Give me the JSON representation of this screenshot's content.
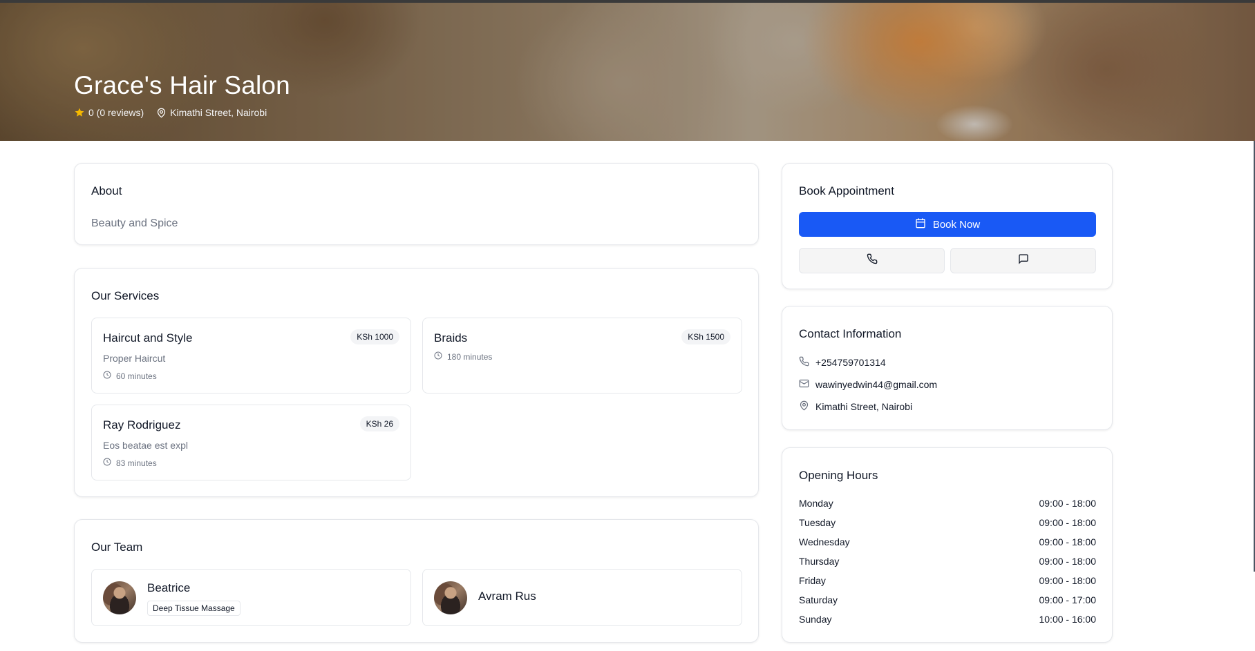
{
  "salon": {
    "name": "Grace's Hair Salon",
    "rating_text": "0 (0 reviews)",
    "location": "Kimathi Street, Nairobi"
  },
  "about": {
    "title": "About",
    "text": "Beauty and Spice"
  },
  "services": {
    "title": "Our Services",
    "items": [
      {
        "name": "Haircut and Style",
        "price": "KSh 1000",
        "description": "Proper Haircut",
        "duration": "60 minutes"
      },
      {
        "name": "Braids",
        "price": "KSh 1500",
        "description": "",
        "duration": "180 minutes"
      },
      {
        "name": "Ray Rodriguez",
        "price": "KSh 26",
        "description": "Eos beatae est expl",
        "duration": "83 minutes"
      }
    ]
  },
  "team": {
    "title": "Our Team",
    "members": [
      {
        "name": "Beatrice",
        "specialty": "Deep Tissue Massage"
      },
      {
        "name": "Avram Rus",
        "specialty": ""
      }
    ]
  },
  "booking": {
    "title": "Book Appointment",
    "book_label": "Book Now",
    "call_icon": "phone-icon",
    "message_icon": "message-icon"
  },
  "contact": {
    "title": "Contact Information",
    "phone": "+254759701314",
    "email": "wawinyedwin44@gmail.com",
    "address": "Kimathi Street, Nairobi"
  },
  "hours": {
    "title": "Opening Hours",
    "days": [
      {
        "day": "Monday",
        "time": "09:00 - 18:00"
      },
      {
        "day": "Tuesday",
        "time": "09:00 - 18:00"
      },
      {
        "day": "Wednesday",
        "time": "09:00 - 18:00"
      },
      {
        "day": "Thursday",
        "time": "09:00 - 18:00"
      },
      {
        "day": "Friday",
        "time": "09:00 - 18:00"
      },
      {
        "day": "Saturday",
        "time": "09:00 - 17:00"
      },
      {
        "day": "Sunday",
        "time": "10:00 - 16:00"
      }
    ]
  },
  "colors": {
    "primary": "#1959f5",
    "star": "#f5b800",
    "muted_text": "#6b7280",
    "border": "#e5e7eb"
  }
}
